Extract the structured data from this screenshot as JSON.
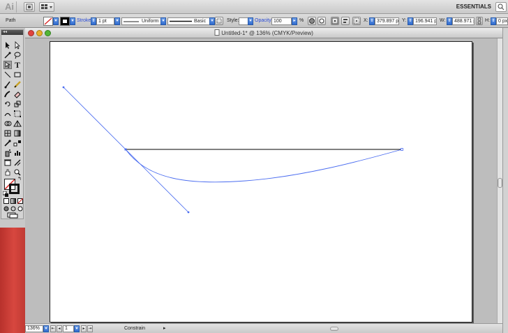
{
  "app_bar": {
    "app_logo": "Ai",
    "workspace": "ESSENTIALS"
  },
  "control_bar": {
    "selection_type": "Path",
    "stroke_label": "Stroke:",
    "stroke_weight": "1 pt",
    "variable_width_profile": "Uniform",
    "brush_definition": "Basic",
    "style_label": "Style:",
    "opacity_label": "Opacity:",
    "opacity_value": "100",
    "opacity_unit": "%",
    "x_label": "X:",
    "x_value": "379.897 px",
    "y_label": "Y:",
    "y_value": "196.941 px",
    "w_label": "W:",
    "w_value": "488.971 px",
    "h_label": "H:",
    "h_value": "0 px"
  },
  "document": {
    "title": "Untitled-1* @ 136% (CMYK/Preview)"
  },
  "status_bar": {
    "zoom": "136%",
    "artboard_number": "1",
    "status_text": "Constrain"
  },
  "tools_panel": {
    "grip_label": "◂◂"
  },
  "colors": {
    "selection_blue": "#4a6cf0",
    "path_stroke": "#000000",
    "left_strip_red": "#c93d36"
  },
  "icons": [
    "bridge-icon",
    "arrange-documents-icon",
    "search-icon",
    "selection-tool-icon",
    "direct-selection-tool-icon",
    "magic-wand-icon",
    "lasso-icon",
    "pen-tool-icon",
    "type-tool-icon",
    "line-segment-icon",
    "rectangle-tool-icon",
    "paintbrush-icon",
    "pencil-icon",
    "blob-brush-icon",
    "eraser-icon",
    "rotate-tool-icon",
    "scale-tool-icon",
    "warp-tool-icon",
    "free-transform-icon",
    "shape-builder-icon",
    "perspective-grid-icon",
    "mesh-tool-icon",
    "gradient-tool-icon",
    "eyedropper-icon",
    "blend-tool-icon",
    "symbol-sprayer-icon",
    "column-graph-icon",
    "artboard-tool-icon",
    "slice-tool-icon",
    "hand-tool-icon",
    "zoom-tool-icon",
    "fill-swatch-icon",
    "stroke-swatch-icon",
    "swap-colors-icon",
    "default-colors-icon",
    "color-mode-icon",
    "gradient-mode-icon",
    "none-mode-icon",
    "draw-normal-icon",
    "draw-behind-icon",
    "draw-inside-icon",
    "screen-mode-icon"
  ]
}
